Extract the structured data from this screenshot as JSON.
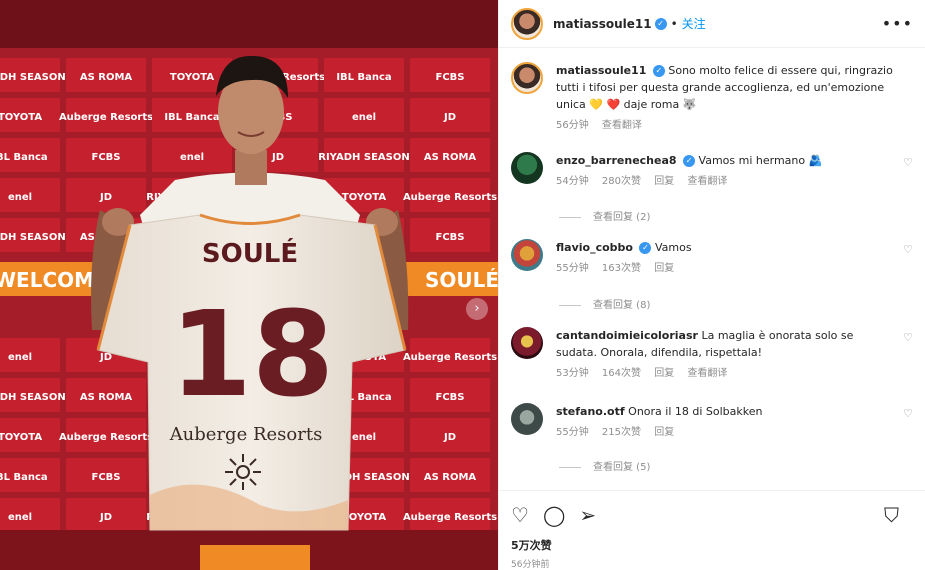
{
  "photo": {
    "board_words": [
      "RIYADH SEASON",
      "AS ROMA",
      "TOYOTA",
      "Auberge Resorts",
      "IBL Banca",
      "FCBS",
      "enel",
      "JD"
    ],
    "banner_text": "WELCOME SOULÉ",
    "banner_right": "SOULÉ",
    "shirt_name": "SOULÉ",
    "shirt_number": "18",
    "shirt_sponsor": "Auberge Resorts"
  },
  "header": {
    "username": "matiassoule11",
    "dot": "•",
    "follow": "关注",
    "more": "•••"
  },
  "caption": {
    "username": "matiassoule11",
    "text": "Sono molto felice di essere qui, ringrazio tutti i tifosi per questa grande accoglienza, ed un'emozione unica 💛 ❤️ daje roma 🐺",
    "time": "56分钟",
    "translate": "查看翻译"
  },
  "comments": [
    {
      "username": "enzo_barrenechea8",
      "text": "Vamos mi hermano 🫂",
      "time": "54分钟",
      "likes": "280次赞",
      "reply": "回复",
      "translate": "查看翻译",
      "view_replies": "查看回复 (2)"
    },
    {
      "username": "flavio_cobbo",
      "text": "Vamos",
      "time": "55分钟",
      "likes": "163次赞",
      "reply": "回复",
      "view_replies": "查看回复 (8)"
    },
    {
      "username": "cantandoimieicoloriasr",
      "text": "La maglia è onorata solo se sudata. Onorala, difendila, rispettala!",
      "time": "53分钟",
      "likes": "164次赞",
      "reply": "回复",
      "translate": "查看翻译"
    },
    {
      "username": "stefano.otf",
      "text": "Onora il 18 di Solbakken",
      "time": "55分钟",
      "likes": "215次赞",
      "reply": "回复",
      "view_replies": "查看回复 (5)"
    }
  ],
  "actions": {
    "likes": "5万次赞",
    "posted": "56分钟前"
  },
  "colors": {
    "accent": "#0095f6",
    "roma_red": "#b01e2a",
    "verified": "#3897f0"
  }
}
